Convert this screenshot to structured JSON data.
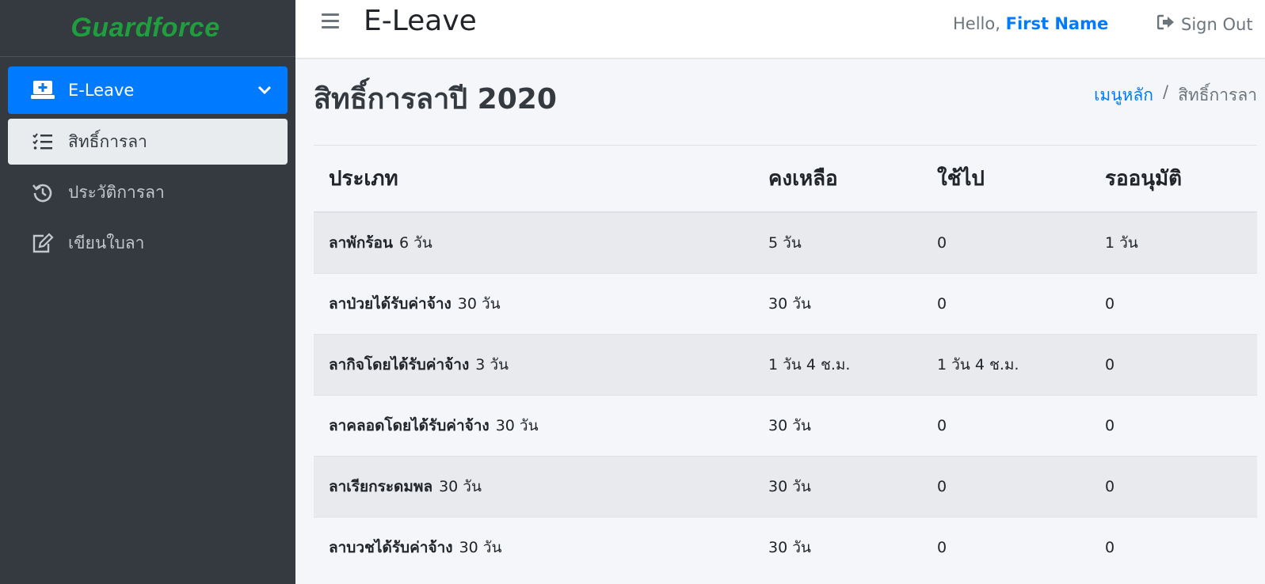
{
  "brand": {
    "logo_text": "Guardforce",
    "logo_color": "#1f9e3e"
  },
  "sidebar": {
    "parent": {
      "label": "E-Leave",
      "icon": "laptop-medical-icon"
    },
    "items": [
      {
        "label": "สิทธิ์การลา",
        "icon": "tasks-icon",
        "active": true
      },
      {
        "label": "ประวัติการลา",
        "icon": "history-icon",
        "active": false
      },
      {
        "label": "เขียนใบลา",
        "icon": "edit-icon",
        "active": false
      }
    ]
  },
  "header": {
    "title": "E-Leave",
    "hello_prefix": "Hello,",
    "user_name": "First Name",
    "signout_label": "Sign Out"
  },
  "page": {
    "title": "สิทธิ์การลาปี 2020",
    "breadcrumb": {
      "home": "เมนูหลัก",
      "separator": "/",
      "current": "สิทธิ์การลา"
    }
  },
  "table": {
    "headers": [
      "ประเภท",
      "คงเหลือ",
      "ใช้ไป",
      "รออนุมัติ"
    ],
    "rows": [
      {
        "type": "ลาพักร้อน",
        "days": "6 วัน",
        "remaining": "5 วัน",
        "used": "0",
        "pending": "1 วัน"
      },
      {
        "type": "ลาป่วยได้รับค่าจ้าง",
        "days": "30 วัน",
        "remaining": "30 วัน",
        "used": "0",
        "pending": "0"
      },
      {
        "type": "ลากิจโดยได้รับค่าจ้าง",
        "days": "3 วัน",
        "remaining": "1 วัน 4 ช.ม.",
        "used": "1 วัน 4 ช.ม.",
        "pending": "0"
      },
      {
        "type": "ลาคลอดโดยได้รับค่าจ้าง",
        "days": "30 วัน",
        "remaining": "30 วัน",
        "used": "0",
        "pending": "0"
      },
      {
        "type": "ลาเรียกระดมพล",
        "days": "30 วัน",
        "remaining": "30 วัน",
        "used": "0",
        "pending": "0"
      },
      {
        "type": "ลาบวชได้รับค่าจ้าง",
        "days": "30 วัน",
        "remaining": "30 วัน",
        "used": "0",
        "pending": "0"
      }
    ]
  },
  "colors": {
    "accent": "#007bff",
    "sidebar_bg": "#343a40",
    "content_bg": "#f4f6f9"
  }
}
